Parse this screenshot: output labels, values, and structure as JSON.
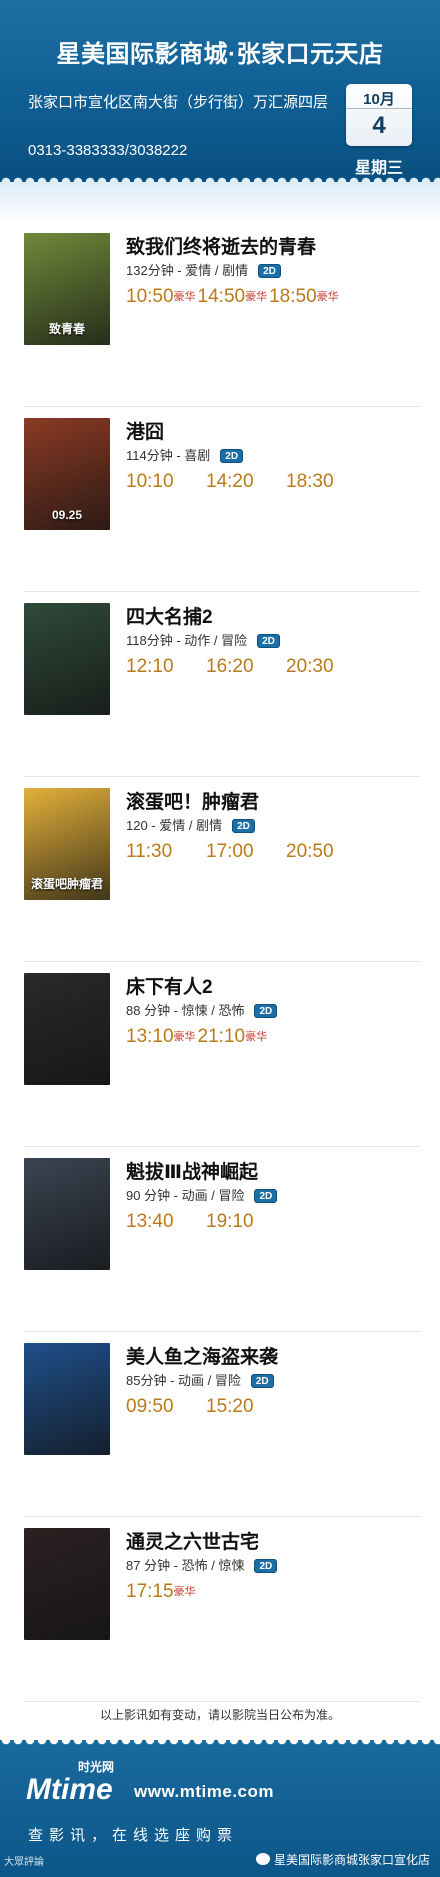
{
  "header": {
    "title": "星美国际影商城·张家口元天店",
    "address": "张家口市宣化区南大街（步行街）万汇源四层",
    "phone": "0313-3383333/3038222",
    "date_month": "10月",
    "date_day": "4",
    "weekday": "星期三"
  },
  "colors": {
    "brand_blue": "#0e5d92",
    "time_gold": "#b97a1a",
    "lux_red": "#c0392b",
    "badge_blue": "#1c6fa6"
  },
  "movies": [
    {
      "title": "致我们终将逝去的青春",
      "info": "132分钟 - 爱情 / 剧情",
      "format": "2D",
      "poster_color": "#6f8a3a",
      "poster_text": "致青春",
      "times": [
        {
          "time": "10:50",
          "tag": "豪华"
        },
        {
          "time": "14:50",
          "tag": "豪华"
        },
        {
          "time": "18:50",
          "tag": "豪华"
        }
      ]
    },
    {
      "title": "港囧",
      "info": "114分钟 - 喜剧",
      "format": "2D",
      "poster_color": "#8a3a24",
      "poster_text": "09.25",
      "times": [
        {
          "time": "10:10",
          "tag": ""
        },
        {
          "time": "14:20",
          "tag": ""
        },
        {
          "time": "18:30",
          "tag": ""
        }
      ]
    },
    {
      "title": "四大名捕2",
      "info": "118分钟 - 动作 / 冒险",
      "format": "2D",
      "poster_color": "#2f4a3a",
      "poster_text": "",
      "times": [
        {
          "time": "12:10",
          "tag": ""
        },
        {
          "time": "16:20",
          "tag": ""
        },
        {
          "time": "20:30",
          "tag": ""
        }
      ]
    },
    {
      "title": "滚蛋吧！肿瘤君",
      "info": "120 - 爱情 / 剧情",
      "format": "2D",
      "poster_color": "#e3b03a",
      "poster_text": "滚蛋吧肿瘤君",
      "times": [
        {
          "time": "11:30",
          "tag": ""
        },
        {
          "time": "17:00",
          "tag": ""
        },
        {
          "time": "20:50",
          "tag": ""
        }
      ]
    },
    {
      "title": "床下有人2",
      "info": "88 分钟 - 惊悚 / 恐怖",
      "format": "2D",
      "poster_color": "#2a2a2a",
      "poster_text": "",
      "times": [
        {
          "time": "13:10",
          "tag": "豪华"
        },
        {
          "time": "21:10",
          "tag": "豪华"
        }
      ]
    },
    {
      "title": "魁拔Ⅲ战神崛起",
      "info": "90 分钟 - 动画 / 冒险",
      "format": "2D",
      "poster_color": "#3a4452",
      "poster_text": "",
      "times": [
        {
          "time": "13:40",
          "tag": ""
        },
        {
          "time": "19:10",
          "tag": ""
        }
      ]
    },
    {
      "title": "美人鱼之海盗来袭",
      "info": "85分钟 - 动画 / 冒险",
      "format": "2D",
      "poster_color": "#1f4f8a",
      "poster_text": "",
      "times": [
        {
          "time": "09:50",
          "tag": ""
        },
        {
          "time": "15:20",
          "tag": ""
        }
      ]
    },
    {
      "title": "通灵之六世古宅",
      "info": "87 分钟 - 恐怖 / 惊悚",
      "format": "2D",
      "poster_color": "#2b2222",
      "poster_text": "",
      "times": [
        {
          "time": "17:15",
          "tag": "豪华"
        }
      ]
    }
  ],
  "notice": "以上影讯如有变动，请以影院当日公布为准。",
  "footer": {
    "logo_text": "Mtime",
    "logo_cn": "时光网",
    "url": "www.mtime.com",
    "slogan": "查影讯，在线选座购票",
    "watermark_left": "大眾評論",
    "watermark_right": "星美国际影商城张家口宣化店"
  }
}
